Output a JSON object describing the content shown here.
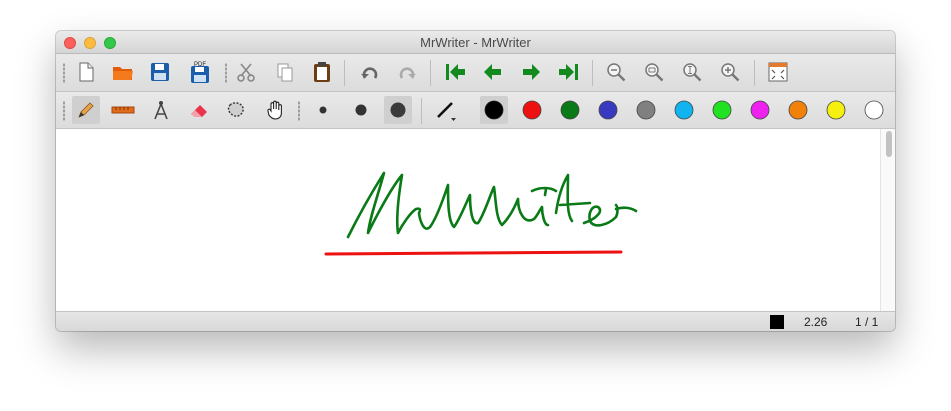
{
  "window": {
    "title": "MrWriter - MrWriter"
  },
  "toolbar_main": {
    "tools": [
      {
        "name": "new-document",
        "icon": "new-document-icon"
      },
      {
        "name": "open",
        "icon": "open-folder-icon"
      },
      {
        "name": "save",
        "icon": "save-icon"
      },
      {
        "name": "export-pdf",
        "icon": "pdf-icon",
        "label": "PDF"
      },
      {
        "name": "cut",
        "icon": "scissors-icon"
      },
      {
        "name": "copy",
        "icon": "copy-icon"
      },
      {
        "name": "paste",
        "icon": "paste-icon"
      },
      {
        "name": "undo",
        "icon": "undo-icon"
      },
      {
        "name": "redo",
        "icon": "redo-icon"
      },
      {
        "name": "first-page",
        "icon": "first-page-icon"
      },
      {
        "name": "previous-page",
        "icon": "previous-page-icon"
      },
      {
        "name": "next-page",
        "icon": "next-page-icon"
      },
      {
        "name": "last-page",
        "icon": "last-page-icon"
      },
      {
        "name": "zoom-out",
        "icon": "zoom-out-icon"
      },
      {
        "name": "zoom-fit-height",
        "icon": "zoom-fit-height-icon"
      },
      {
        "name": "zoom-fit-width",
        "icon": "zoom-fit-width-icon"
      },
      {
        "name": "zoom-in",
        "icon": "zoom-in-icon"
      },
      {
        "name": "fullscreen",
        "icon": "fullscreen-icon"
      }
    ]
  },
  "toolbar_tools": {
    "tools": [
      "pen-icon",
      "ruler-icon",
      "compass-icon",
      "eraser-icon",
      "lasso-select-icon",
      "hand-icon"
    ],
    "pen_widths": [
      "fine",
      "medium",
      "thick"
    ],
    "selected_width": "thick",
    "pattern_icon": "pen-pattern-icon",
    "colors": [
      "#000000",
      "#ee1111",
      "#0a7a17",
      "#3a3ac0",
      "#808080",
      "#11b4ee",
      "#22e022",
      "#ee22ee",
      "#f0820a",
      "#f5f010",
      "#ffffff"
    ],
    "selected_color": "#000000"
  },
  "canvas": {
    "handwriting_color": "#0a7a17",
    "underline_color": "#ee1111"
  },
  "status": {
    "color": "#000000",
    "pen_width": "2.26",
    "page": "1 / 1"
  }
}
